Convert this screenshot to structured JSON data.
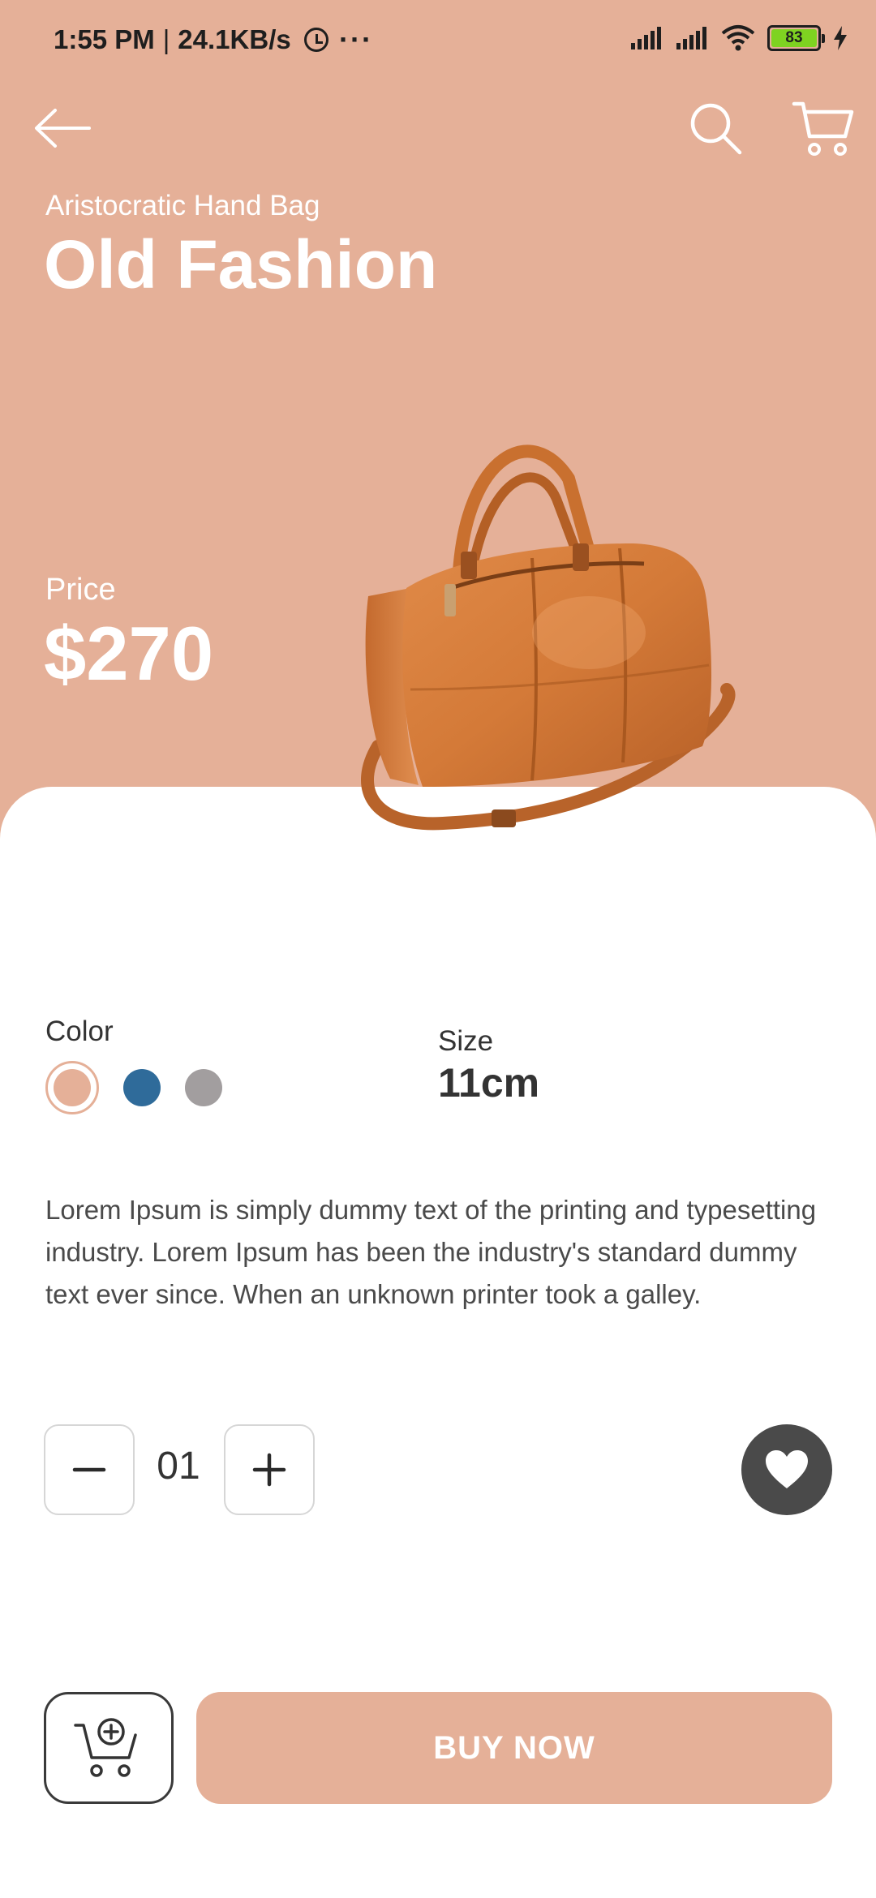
{
  "status_bar": {
    "time": "1:55 PM",
    "network_speed": "24.1KB/s",
    "more": "···",
    "battery_level": "83",
    "icons": [
      "alarm-icon",
      "signal-icon",
      "signal-icon",
      "wifi-icon",
      "battery-icon",
      "charging-icon"
    ]
  },
  "app_bar": {
    "icons": [
      "back-arrow-icon",
      "search-icon",
      "cart-icon"
    ]
  },
  "product": {
    "category": "Aristocratic Hand Bag",
    "name": "Old Fashion",
    "price_label": "Price",
    "price": "$270",
    "image_icon": "handbag-image"
  },
  "options": {
    "color_label": "Color",
    "colors": [
      "#E5B098",
      "#2F6B9A",
      "#A29E9F"
    ],
    "selected_color_index": 0,
    "size_label": "Size",
    "size_value": "11cm"
  },
  "description": "Lorem Ipsum is simply dummy text of the printing and typesetting industry. Lorem Ipsum has been the industry's standard dummy text ever since. When an unknown printer took a galley.",
  "quantity": {
    "value": "01",
    "decrement_icon": "minus-icon",
    "increment_icon": "plus-icon"
  },
  "favorite_icon": "heart-icon",
  "actions": {
    "add_to_cart_icon": "cart-plus-icon",
    "buy_label": "BUY NOW"
  },
  "theme": {
    "accent": "#E5B098",
    "dark": "#4a4a4a"
  }
}
